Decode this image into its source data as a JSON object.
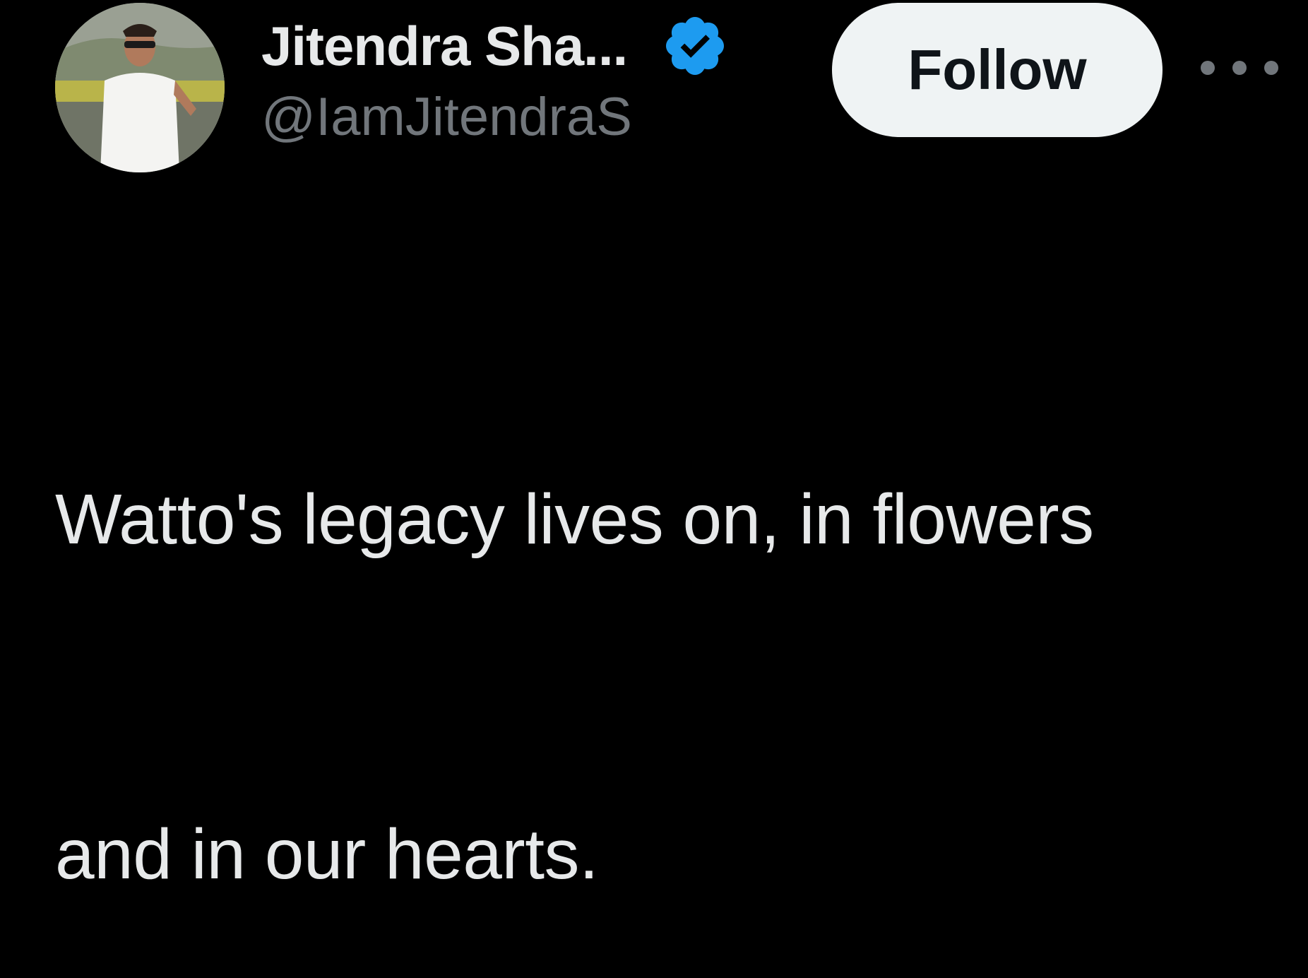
{
  "author": {
    "display_name": "Jitendra Sha...",
    "handle": "@IamJitendraS",
    "verified": true,
    "avatar_icon": "user-avatar-photo",
    "badge_icon": "verified-badge-icon"
  },
  "actions": {
    "follow_label": "Follow",
    "more_icon": "more-options-icon"
  },
  "tweet": {
    "text_line_1": "Watto's legacy lives on, in flowers",
    "text_line_2": "and in our hearts."
  },
  "colors": {
    "background": "#000000",
    "primary_text": "#e7e9ea",
    "secondary_text": "#71767b",
    "verified_blue": "#1d9bf0",
    "follow_bg": "#eff3f4",
    "follow_text": "#0f1419"
  }
}
